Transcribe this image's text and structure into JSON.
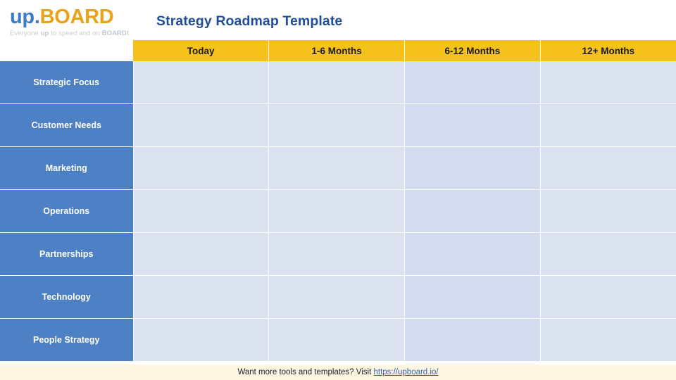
{
  "logo": {
    "word_up": "up.",
    "word_board": "BOARD",
    "tagline_pre": "Everyone ",
    "tagline_bold1": "up",
    "tagline_mid": " to speed and on ",
    "tagline_bold2": "BOARD!",
    "color_up": "#3d7cc9",
    "color_board": "#e8a317"
  },
  "title": "Strategy Roadmap Template",
  "table": {
    "header_blank": "",
    "columns": [
      "Today",
      "1-6 Months",
      "6-12 Months",
      "12+ Months"
    ],
    "rows": [
      {
        "label": "Strategic Focus",
        "cells": [
          "",
          "",
          "",
          ""
        ]
      },
      {
        "label": "Customer Needs",
        "cells": [
          "",
          "",
          "",
          ""
        ]
      },
      {
        "label": "Marketing",
        "cells": [
          "",
          "",
          "",
          ""
        ]
      },
      {
        "label": "Operations",
        "cells": [
          "",
          "",
          "",
          ""
        ]
      },
      {
        "label": "Partnerships",
        "cells": [
          "",
          "",
          "",
          ""
        ]
      },
      {
        "label": "Technology",
        "cells": [
          "",
          "",
          "",
          ""
        ]
      },
      {
        "label": "People Strategy",
        "cells": [
          "",
          "",
          "",
          ""
        ]
      }
    ],
    "header_bg": "#f5c21b",
    "label_bg": "#4d80c4",
    "cell_bg": "#dbe3f1"
  },
  "footer": {
    "text": "Want more tools and templates? Visit ",
    "link_text": "https://upboard.io/",
    "bg": "#fdf6e0"
  }
}
